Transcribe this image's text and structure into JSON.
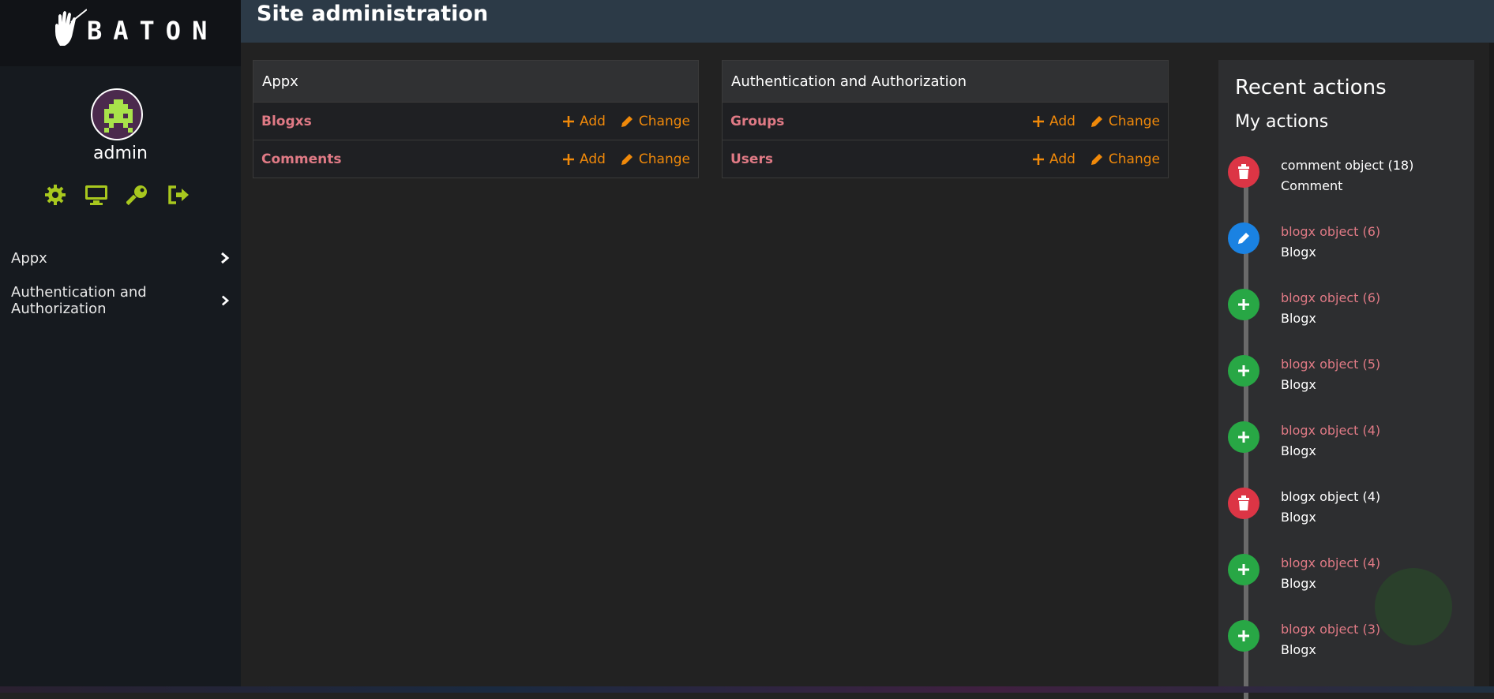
{
  "brand": {
    "logo_text": "BATON"
  },
  "user": {
    "name": "admin"
  },
  "user_icons": [
    "gear-icon",
    "monitor-icon",
    "key-icon",
    "logout-icon"
  ],
  "nav": {
    "items": [
      {
        "label": "Appx"
      },
      {
        "label": "Authentication and Authorization"
      }
    ]
  },
  "header": {
    "title": "Site administration"
  },
  "modules": [
    {
      "title": "Appx",
      "rows": [
        {
          "model": "Blogxs",
          "add": "Add",
          "change": "Change"
        },
        {
          "model": "Comments",
          "add": "Add",
          "change": "Change"
        }
      ]
    },
    {
      "title": "Authentication and Authorization",
      "rows": [
        {
          "model": "Groups",
          "add": "Add",
          "change": "Change"
        },
        {
          "model": "Users",
          "add": "Add",
          "change": "Change"
        }
      ]
    }
  ],
  "recent": {
    "title": "Recent actions",
    "subtitle": "My actions",
    "actions": [
      {
        "kind": "delete",
        "title": "comment object (18)",
        "type": "Comment"
      },
      {
        "kind": "change",
        "title": "blogx object (6)",
        "type": "Blogx"
      },
      {
        "kind": "add",
        "title": "blogx object (6)",
        "type": "Blogx"
      },
      {
        "kind": "add",
        "title": "blogx object (5)",
        "type": "Blogx"
      },
      {
        "kind": "add",
        "title": "blogx object (4)",
        "type": "Blogx"
      },
      {
        "kind": "delete",
        "title": "blogx object (4)",
        "type": "Blogx"
      },
      {
        "kind": "add",
        "title": "blogx object (4)",
        "type": "Blogx"
      },
      {
        "kind": "add",
        "title": "blogx object (3)",
        "type": "Blogx"
      }
    ]
  },
  "colors": {
    "accent_orange": "#f0890a",
    "link_pink": "#e07a85",
    "icon_green": "#a8c81e",
    "delete_red": "#dc3545",
    "change_blue": "#1a82e2",
    "add_green": "#28a745"
  }
}
